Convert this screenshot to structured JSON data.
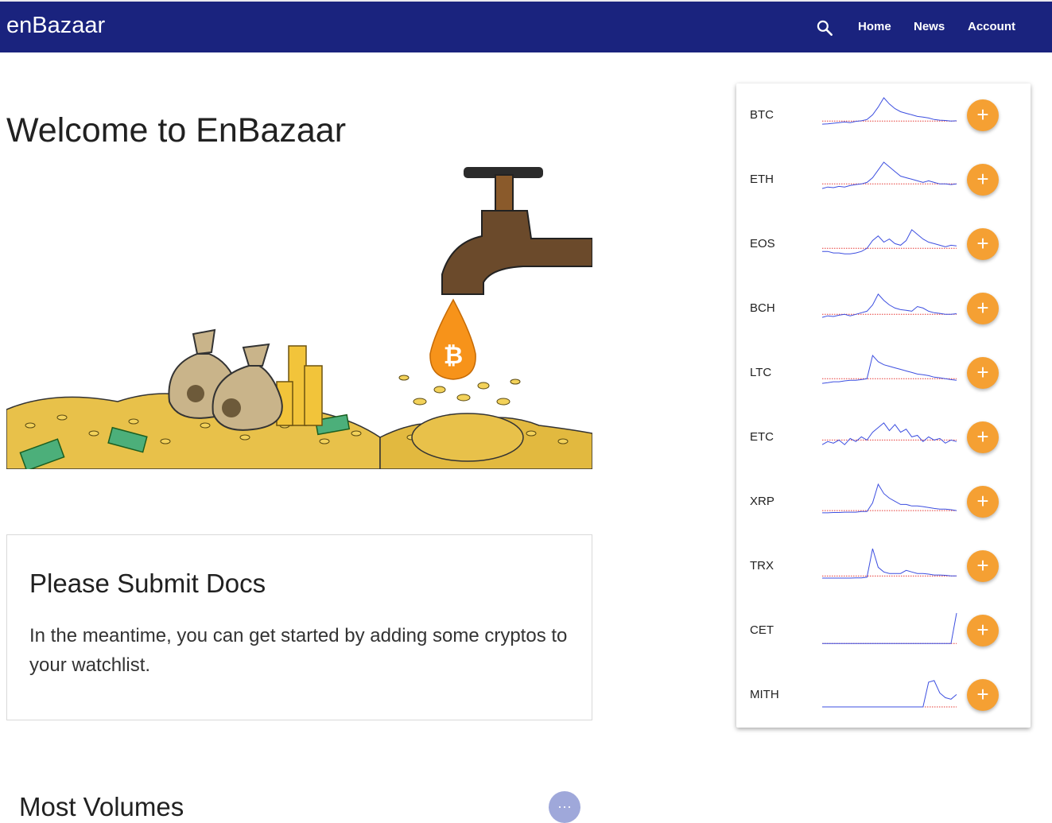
{
  "header": {
    "brand": "enBazaar",
    "nav": {
      "home": "Home",
      "news": "News",
      "account": "Account"
    }
  },
  "main": {
    "welcome_title": "Welcome to EnBazaar",
    "docs_card": {
      "title": "Please Submit Docs",
      "text": "In the meantime, you can get started by adding some cryptos to your watchlist."
    },
    "volumes_title": "Most Volumes",
    "more_label": "···"
  },
  "watchlist": {
    "add_label": "+",
    "coins": [
      {
        "symbol": "BTC",
        "spark": [
          0.15,
          0.16,
          0.18,
          0.2,
          0.22,
          0.2,
          0.24,
          0.26,
          0.3,
          0.45,
          0.7,
          1.0,
          0.8,
          0.65,
          0.55,
          0.5,
          0.45,
          0.4,
          0.38,
          0.35,
          0.3,
          0.28,
          0.27,
          0.25,
          0.26
        ],
        "baseline": 0.25
      },
      {
        "symbol": "ETH",
        "spark": [
          0.15,
          0.2,
          0.18,
          0.22,
          0.2,
          0.25,
          0.28,
          0.3,
          0.35,
          0.5,
          0.75,
          1.0,
          0.85,
          0.7,
          0.55,
          0.5,
          0.45,
          0.4,
          0.35,
          0.4,
          0.35,
          0.3,
          0.3,
          0.28,
          0.3
        ],
        "baseline": 0.3
      },
      {
        "symbol": "EOS",
        "spark": [
          0.2,
          0.2,
          0.15,
          0.15,
          0.12,
          0.12,
          0.15,
          0.2,
          0.3,
          0.55,
          0.7,
          0.5,
          0.6,
          0.45,
          0.4,
          0.55,
          0.9,
          0.75,
          0.6,
          0.5,
          0.45,
          0.4,
          0.35,
          0.4,
          0.38
        ],
        "baseline": 0.3
      },
      {
        "symbol": "BCH",
        "spark": [
          0.15,
          0.2,
          0.18,
          0.22,
          0.25,
          0.2,
          0.25,
          0.3,
          0.35,
          0.55,
          0.9,
          0.7,
          0.55,
          0.45,
          0.4,
          0.38,
          0.35,
          0.5,
          0.45,
          0.35,
          0.3,
          0.28,
          0.25,
          0.25,
          0.27
        ],
        "baseline": 0.25
      },
      {
        "symbol": "LTC",
        "spark": [
          0.1,
          0.12,
          0.15,
          0.15,
          0.18,
          0.2,
          0.2,
          0.22,
          0.25,
          1.0,
          0.8,
          0.7,
          0.65,
          0.6,
          0.55,
          0.5,
          0.45,
          0.4,
          0.38,
          0.35,
          0.3,
          0.28,
          0.25,
          0.22,
          0.2
        ],
        "baseline": 0.25
      },
      {
        "symbol": "ETC",
        "spark": [
          0.2,
          0.3,
          0.25,
          0.35,
          0.2,
          0.4,
          0.3,
          0.45,
          0.35,
          0.6,
          0.75,
          0.9,
          0.65,
          0.85,
          0.6,
          0.7,
          0.45,
          0.5,
          0.3,
          0.45,
          0.35,
          0.4,
          0.25,
          0.35,
          0.3
        ],
        "baseline": 0.35
      },
      {
        "symbol": "XRP",
        "spark": [
          0.08,
          0.08,
          0.09,
          0.09,
          0.1,
          0.1,
          0.1,
          0.12,
          0.12,
          0.4,
          1.0,
          0.7,
          0.55,
          0.45,
          0.35,
          0.35,
          0.3,
          0.3,
          0.28,
          0.25,
          0.22,
          0.2,
          0.2,
          0.18,
          0.15
        ],
        "baseline": 0.15
      },
      {
        "symbol": "TRX",
        "spark": [
          0.05,
          0.05,
          0.05,
          0.05,
          0.05,
          0.05,
          0.06,
          0.06,
          0.08,
          1.0,
          0.4,
          0.25,
          0.2,
          0.2,
          0.2,
          0.3,
          0.25,
          0.2,
          0.2,
          0.18,
          0.15,
          0.15,
          0.14,
          0.12,
          0.12
        ],
        "baseline": 0.12
      },
      {
        "symbol": "CET",
        "spark": [
          0.02,
          0.02,
          0.02,
          0.02,
          0.02,
          0.02,
          0.02,
          0.02,
          0.02,
          0.02,
          0.02,
          0.02,
          0.02,
          0.02,
          0.02,
          0.02,
          0.02,
          0.02,
          0.02,
          0.02,
          0.02,
          0.02,
          0.02,
          0.02,
          1.0
        ],
        "baseline": 0.02
      },
      {
        "symbol": "MITH",
        "spark": [
          0.05,
          0.05,
          0.05,
          0.05,
          0.05,
          0.05,
          0.05,
          0.05,
          0.05,
          0.05,
          0.05,
          0.05,
          0.05,
          0.05,
          0.05,
          0.05,
          0.05,
          0.05,
          0.05,
          0.85,
          0.9,
          0.5,
          0.35,
          0.3,
          0.45
        ],
        "baseline": 0.05
      }
    ]
  },
  "colors": {
    "appbar": "#1a237e",
    "accent_orange": "#f5a033",
    "spark_line": "#3d4fe0",
    "baseline_dots": "#e53935"
  }
}
